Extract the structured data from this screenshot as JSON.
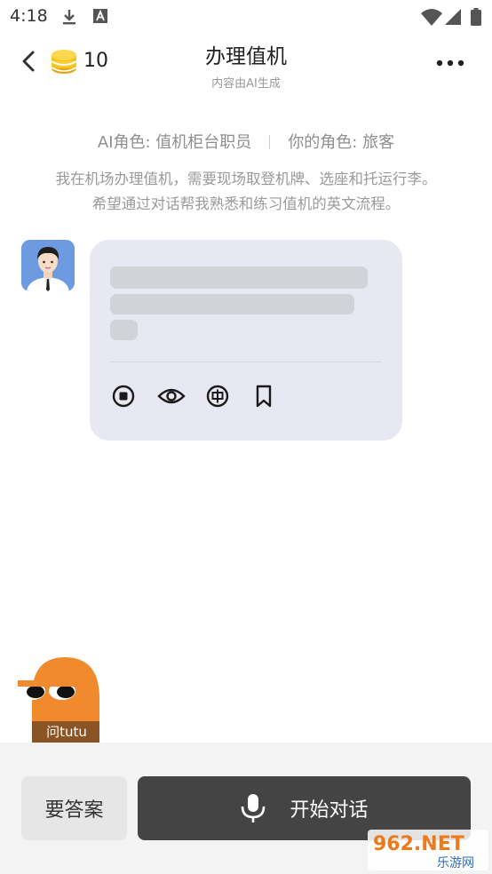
{
  "status_bar": {
    "time": "4:18",
    "icons": [
      "download-icon",
      "font-icon",
      "wifi-icon",
      "signal-icon",
      "battery-icon"
    ]
  },
  "header": {
    "coin_count": "10",
    "title": "办理值机",
    "subtitle": "内容由AI生成"
  },
  "roles": {
    "ai_role": "AI角色: 值机柜台职员",
    "user_role": "你的角色: 旅客"
  },
  "scenario": {
    "line1": "我在机场办理值机，需要现场取登机牌、选座和托运行李。",
    "line2": "希望通过对话帮我熟悉和练习值机的英文流程。"
  },
  "message_actions": [
    "stop-icon",
    "eye-icon",
    "translate-zh-icon",
    "bookmark-icon"
  ],
  "mascot": {
    "label": "问tutu"
  },
  "bottom": {
    "answer_label": "要答案",
    "start_label": "开始对话"
  },
  "watermark": {
    "top": "962.NET",
    "bottom": "乐游网"
  },
  "colors": {
    "bubble": "#e8e8f2",
    "start_button": "#444444",
    "coin": "#f6c21c",
    "mascot": "#f08a2c"
  }
}
